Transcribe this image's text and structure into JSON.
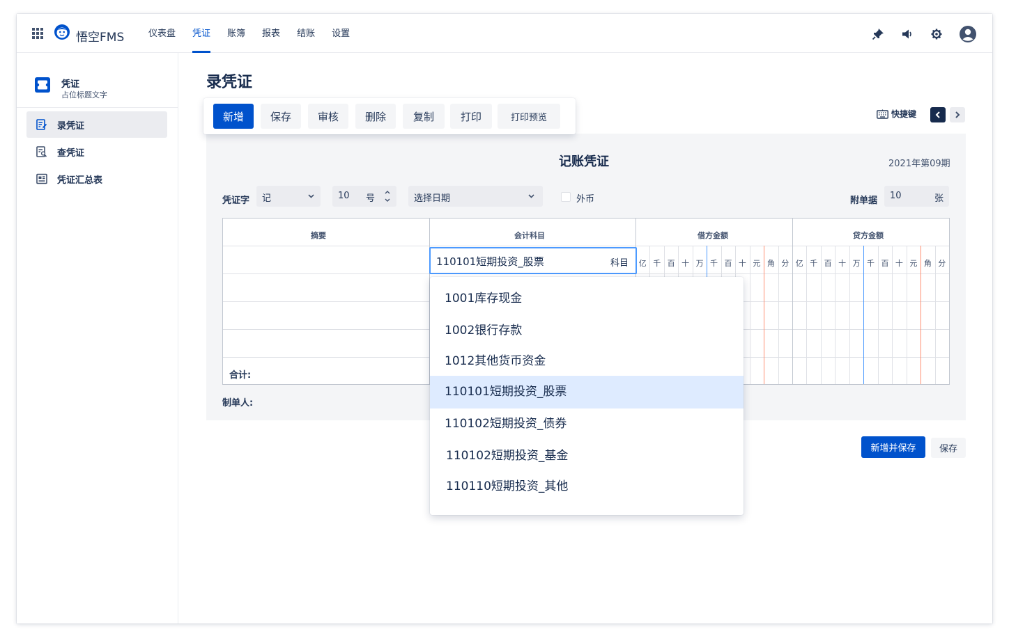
{
  "app": {
    "name": "悟空FMS"
  },
  "nav": {
    "links": [
      {
        "label": "仪表盘"
      },
      {
        "label": "凭证",
        "active": true
      },
      {
        "label": "账簿"
      },
      {
        "label": "报表"
      },
      {
        "label": "结账"
      },
      {
        "label": "设置"
      }
    ],
    "icons": [
      "pin-icon",
      "megaphone-icon",
      "gear-icon",
      "user-avatar-icon"
    ]
  },
  "sidebar": {
    "title": "凭证",
    "subtitle": "占位标题文字",
    "items": [
      {
        "label": "录凭证",
        "icon": "edit-document-icon",
        "active": true
      },
      {
        "label": "查凭证",
        "icon": "search-document-icon"
      },
      {
        "label": "凭证汇总表",
        "icon": "summary-table-icon"
      }
    ]
  },
  "page": {
    "title": "录凭证"
  },
  "toolbar": {
    "buttons": [
      "新增",
      "保存",
      "审核",
      "删除",
      "复制",
      "打印",
      "打印预览"
    ],
    "shortcut_label": "快捷键"
  },
  "voucher": {
    "title": "记账凭证",
    "period": "2021年第09期",
    "word_label": "凭证字",
    "word_value": "记",
    "number_value": "10",
    "number_unit": "号",
    "date_placeholder": "选择日期",
    "foreign_currency_label": "外币",
    "attachments_label": "附单据",
    "attachments_value": "10",
    "attachments_unit": "张",
    "headers": {
      "summary": "摘要",
      "subject": "会计科目",
      "debit": "借方金额",
      "credit": "贷方金额"
    },
    "digits": [
      "亿",
      "千",
      "百",
      "十",
      "万",
      "千",
      "百",
      "十",
      "元",
      "角",
      "分"
    ],
    "total_label": "合计:",
    "maker_label": "制单人:",
    "subject_input_value": "110101短期投资_股票",
    "subject_input_suffix": "科目"
  },
  "subject_dropdown": {
    "options": [
      {
        "label": "1001库存现金"
      },
      {
        "label": "1002银行存款"
      },
      {
        "label": "1012其他货币资金"
      },
      {
        "label": "110101短期投资_股票",
        "selected": true
      },
      {
        "label": "110102短期投资_债券"
      },
      {
        "label": "110102短期投资_基金"
      },
      {
        "label": "110110短期投资_其他"
      }
    ]
  },
  "actions": {
    "save_and_new": "新增并保存",
    "save": "保存"
  },
  "colors": {
    "primary": "#0052cc",
    "selected_row": "#deebff",
    "focus_border": "#4c9aff",
    "panel_bg": "#f4f5f7",
    "yuan_divider": "#ff8f73",
    "wan_divider": "#4c9aff"
  }
}
